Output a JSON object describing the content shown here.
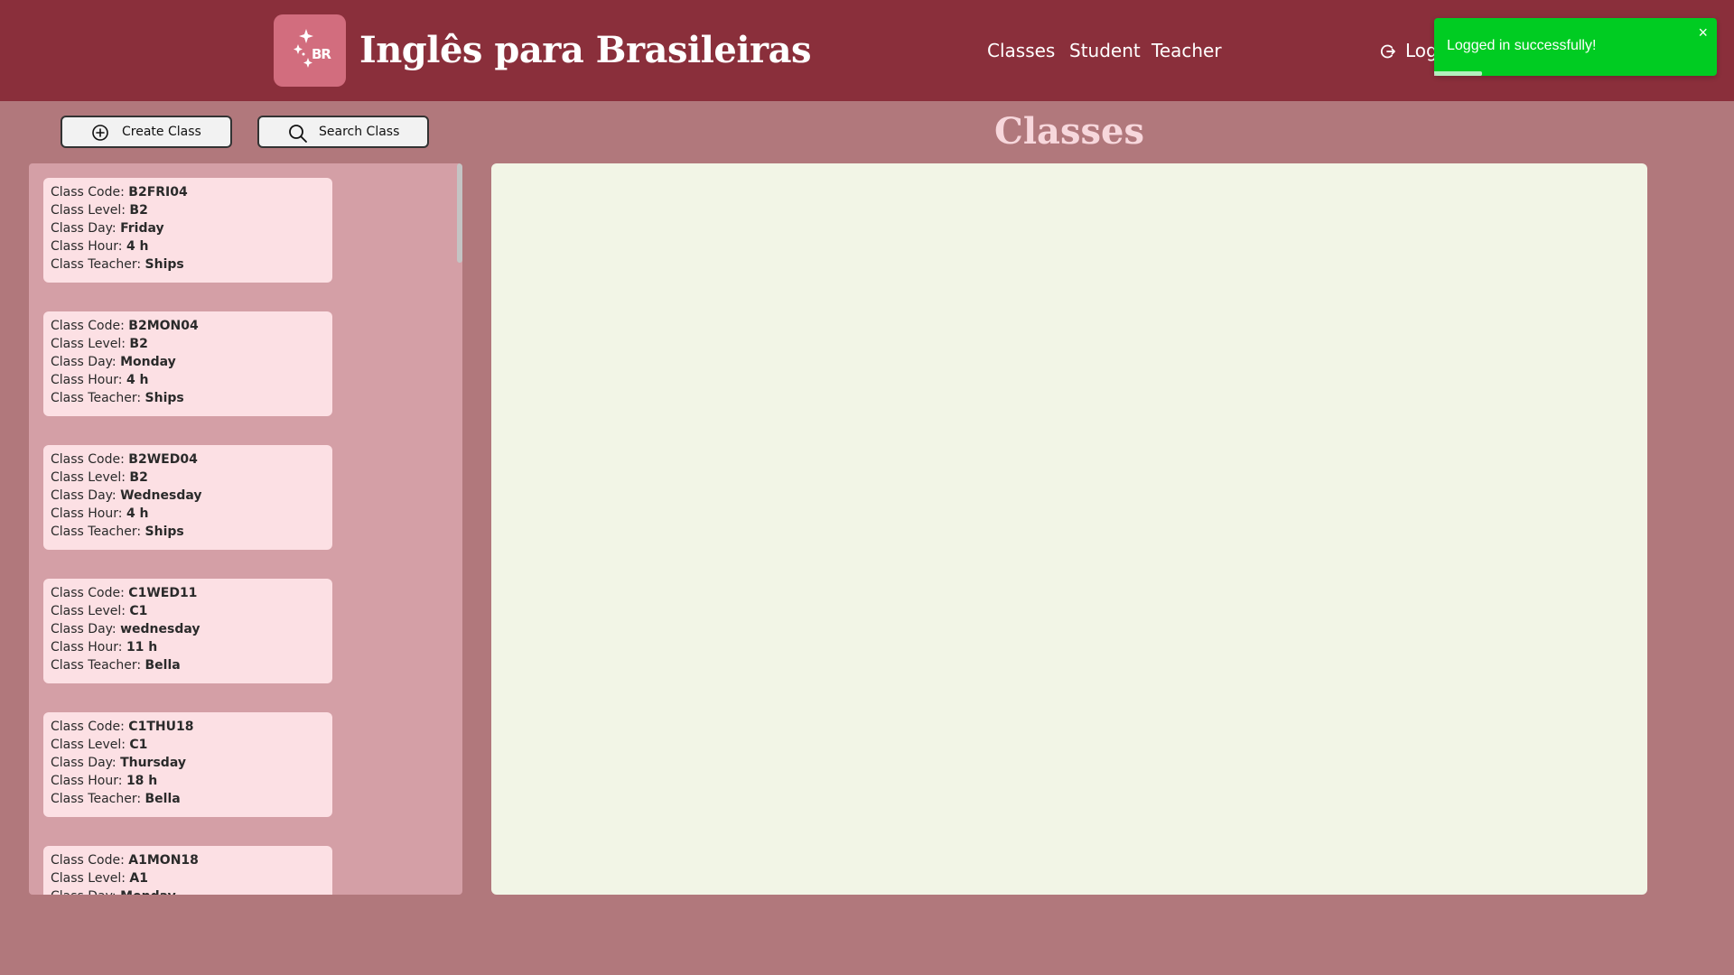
{
  "brand": {
    "title": "Inglês para Brasileiras",
    "logo_letters": "BR"
  },
  "nav": {
    "classes": "Classes",
    "student": "Student",
    "teacher": "Teacher",
    "logout": "Log"
  },
  "toast": {
    "message": "Logged in successfully!",
    "close": "×",
    "progress_fraction": 0.17
  },
  "toolbar": {
    "create_label": "Create Class",
    "search_label": "Search Class"
  },
  "page": {
    "heading": "Classes"
  },
  "labels": {
    "code": "Class Code: ",
    "level": "Class Level: ",
    "day": "Class Day: ",
    "hour": "Class Hour: ",
    "teacher": "Class Teacher: "
  },
  "classes": [
    {
      "code": "B2FRI04",
      "level": "B2",
      "day": "Friday",
      "hour": "4 h",
      "teacher": "Ships"
    },
    {
      "code": "B2MON04",
      "level": "B2",
      "day": "Monday",
      "hour": "4 h",
      "teacher": "Ships"
    },
    {
      "code": "B2WED04",
      "level": "B2",
      "day": "Wednesday",
      "hour": "4 h",
      "teacher": "Ships"
    },
    {
      "code": "C1WED11",
      "level": "C1",
      "day": "wednesday",
      "hour": "11 h",
      "teacher": "Bella"
    },
    {
      "code": "C1THU18",
      "level": "C1",
      "day": "Thursday",
      "hour": "18 h",
      "teacher": "Bella"
    },
    {
      "code": "A1MON18",
      "level": "A1",
      "day": "Monday",
      "hour": "",
      "teacher": ""
    }
  ],
  "colors": {
    "header": "#8a2f3b",
    "background": "#b1787c",
    "toast": "#00cc22",
    "card": "#fce0e4",
    "detail_panel": "#f2f5e6"
  }
}
